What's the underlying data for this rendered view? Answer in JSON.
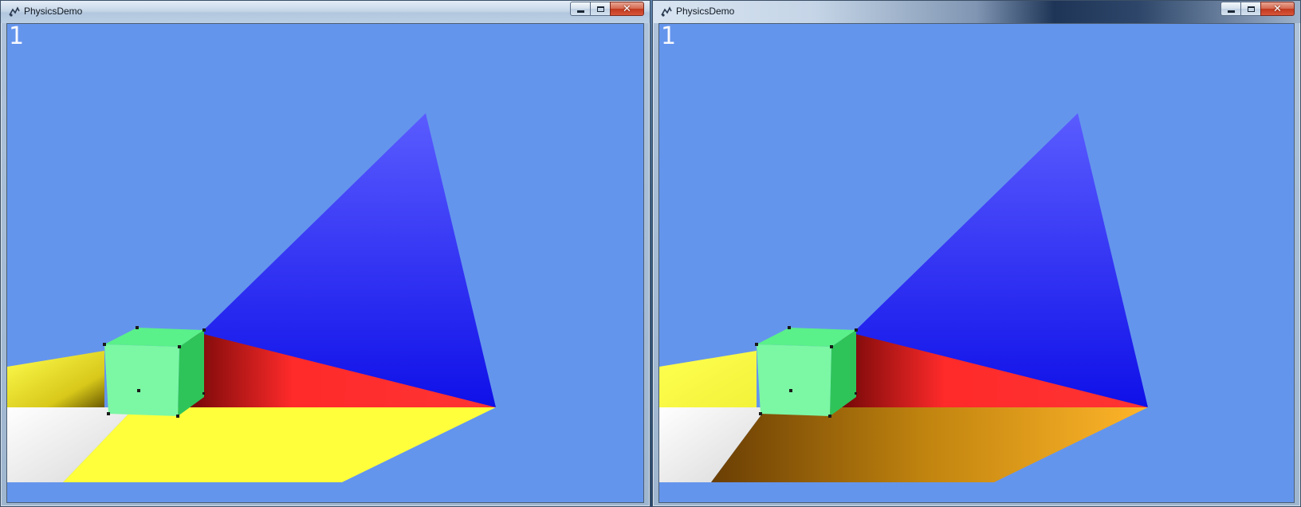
{
  "colors": {
    "sky": "#6495ed",
    "blue_triangle_top": "#5a5cff",
    "blue_triangle_bottom": "#0f10e8",
    "red_plane": "#ff2a2a",
    "yellow_plane": "#ffff3c",
    "orange_plane_dark": "#7a4a06",
    "orange_plane_light": "#ffb52a",
    "white_plane": "#ffffff",
    "cube_front": "#7cf7a4",
    "cube_top": "#5af08a",
    "cube_side": "#2fc45a"
  },
  "windows": [
    {
      "id": "left",
      "title": "PhysicsDemo",
      "frame_counter": "1",
      "floor_style": "yellow"
    },
    {
      "id": "right",
      "title": "PhysicsDemo",
      "frame_counter": "1",
      "floor_style": "orange"
    }
  ],
  "caption_buttons": {
    "minimize": "minimize-icon",
    "maximize": "maximize-icon",
    "close": "close-icon"
  }
}
